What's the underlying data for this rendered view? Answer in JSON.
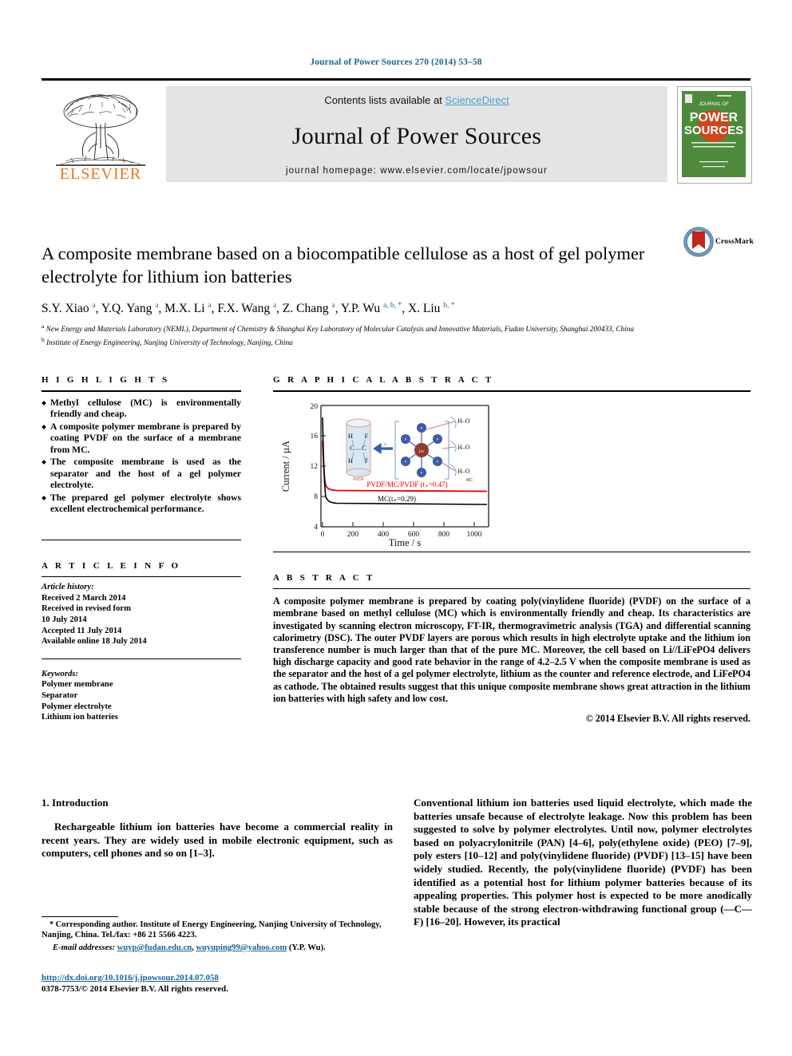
{
  "running_head": "Journal of Power Sources 270 (2014) 53–58",
  "masthead": {
    "publisher_name": "ELSEVIER",
    "contents_prefix": "Contents lists available at ",
    "contents_link": "ScienceDirect",
    "journal_title": "Journal of Power Sources",
    "homepage": "journal homepage: www.elsevier.com/locate/jpowsour",
    "cover_line1": "JOURNAL OF",
    "cover_line2": "POWER",
    "cover_line3": "SOURCES"
  },
  "article": {
    "title": "A composite membrane based on a biocompatible cellulose as a host of gel polymer electrolyte for lithium ion batteries",
    "crossmark_label": "CrossMark",
    "authors": [
      {
        "name": "S.Y. Xiao",
        "marks": "a"
      },
      {
        "name": "Y.Q. Yang",
        "marks": "a"
      },
      {
        "name": "M.X. Li",
        "marks": "a"
      },
      {
        "name": "F.X. Wang",
        "marks": "a"
      },
      {
        "name": "Z. Chang",
        "marks": "a"
      },
      {
        "name": "Y.P. Wu",
        "marks": "a, b, *"
      },
      {
        "name": "X. Liu",
        "marks": "b, *"
      }
    ],
    "affiliations": [
      {
        "mark": "a",
        "text": "New Energy and Materials Laboratory (NEML), Department of Chemistry & Shanghai Key Laboratory of Molecular Catalysis and Innovative Materials, Fudan University, Shanghai 200433, China"
      },
      {
        "mark": "b",
        "text": "Institute of Energy Engineering, Nanjing University of Technology, Nanjing, China"
      }
    ]
  },
  "highlights": {
    "heading": "H I G H L I G H T S",
    "items": [
      "Methyl cellulose (MC) is environmentally friendly and cheap.",
      "A composite polymer membrane is prepared by coating PVDF on the surface of a membrane from MC.",
      "The composite membrane is used as the separator and the host of a gel polymer electrolyte.",
      "The prepared gel polymer electrolyte shows excellent electrochemical performance."
    ]
  },
  "graphical_abstract": {
    "heading": "G R A P H I C A L   A B S T R A C T"
  },
  "chart_data": {
    "type": "line",
    "title": "",
    "xlabel": "Time / s",
    "ylabel": "Current / µA",
    "xlim": [
      0,
      1100
    ],
    "ylim": [
      4,
      20
    ],
    "xticks": [
      0,
      200,
      400,
      600,
      800,
      1000
    ],
    "yticks": [
      4,
      8,
      12,
      16,
      20
    ],
    "grid": false,
    "legend_position": "inline-annotation",
    "series": [
      {
        "name": "PVDF/MC/PVDF (t+=0.47)",
        "color": "#e00000",
        "annotation": "PVDF/MC/PVDF (t₊=0.47)",
        "x": [
          0,
          3,
          6,
          10,
          20,
          50,
          100,
          200,
          400,
          600,
          800,
          1000
        ],
        "y": [
          15.2,
          10.5,
          8.4,
          7.6,
          7.3,
          7.2,
          7.15,
          7.1,
          7.08,
          7.05,
          7.05,
          7.0
        ]
      },
      {
        "name": "MC (t+=0.29)",
        "color": "#000000",
        "annotation": "MC(t₊=0.29)",
        "x": [
          0,
          3,
          6,
          10,
          20,
          50,
          100,
          200,
          400,
          600,
          800,
          1000
        ],
        "y": [
          18.3,
          10.2,
          7.5,
          6.4,
          5.9,
          5.6,
          5.5,
          5.4,
          5.35,
          5.3,
          5.25,
          5.2
        ]
      }
    ],
    "inset": {
      "left_label": "PVDF",
      "right_label": "MC",
      "center_ion": "Li+",
      "arrow_label": "e-",
      "pvdf_atoms": [
        "H",
        "F",
        "C",
        "C",
        "H",
        "F"
      ],
      "solvent_labels": [
        "H–O",
        "H–O",
        "H–O"
      ],
      "ligand_labels": [
        "F",
        "F",
        "F",
        "F",
        "F",
        "F"
      ]
    }
  },
  "article_info": {
    "heading": "A R T I C L E   I N F O",
    "history_label": "Article history:",
    "history": [
      "Received 2 March 2014",
      "Received in revised form",
      "10 July 2014",
      "Accepted 11 July 2014",
      "Available online 18 July 2014"
    ],
    "keywords_label": "Keywords:",
    "keywords": [
      "Polymer membrane",
      "Separator",
      "Polymer electrolyte",
      "Lithium ion batteries"
    ]
  },
  "abstract": {
    "heading": "A B S T R A C T",
    "text": "A composite polymer membrane is prepared by coating poly(vinylidene fluoride) (PVDF) on the surface of a membrane based on methyl cellulose (MC) which is environmentally friendly and cheap. Its characteristics are investigated by scanning electron microscopy, FT-IR, thermogravimetric analysis (TGA) and differential scanning calorimetry (DSC). The outer PVDF layers are porous which results in high electrolyte uptake and the lithium ion transference number is much larger than that of the pure MC. Moreover, the cell based on Li//LiFePO4 delivers high discharge capacity and good rate behavior in the range of 4.2–2.5 V when the composite membrane is used as the separator and the host of a gel polymer electrolyte, lithium as the counter and reference electrode, and LiFePO4 as cathode. The obtained results suggest that this unique composite membrane shows great attraction in the lithium ion batteries with high safety and low cost.",
    "copyright": "© 2014 Elsevier B.V. All rights reserved."
  },
  "body": {
    "section_title": "1.  Introduction",
    "left_paragraph": "Rechargeable lithium ion batteries have become a commercial reality in recent years. They are widely used in mobile electronic equipment, such as computers, cell phones and so on [1–3].",
    "right_paragraph": "Conventional lithium ion batteries used liquid electrolyte, which made the batteries unsafe because of electrolyte leakage. Now this problem has been suggested to solve by polymer electrolytes. Until now, polymer electrolytes based on polyacrylonitrile (PAN) [4–6], poly(ethylene oxide) (PEO) [7–9], poly esters [10–12] and poly(vinylidene fluoride) (PVDF) [13–15] have been widely studied. Recently, the poly(vinylidene fluoride) (PVDF) has been identified as a potential host for lithium polymer batteries because of its appealing properties. This polymer host is expected to be more anodically stable because of the strong electron-withdrawing functional group (—C—F) [16–20]. However, its practical"
  },
  "footer": {
    "corresponding_star": "*",
    "corresponding_text": "Corresponding author. Institute of Energy Engineering, Nanjing University of Technology, Nanjing, China. Tel./fax: +86 21 5566 4223.",
    "email_label": "E-mail addresses:",
    "email1": "wuyp@fudan.edu.cn",
    "email2": "wuyuping99@yahoo.com",
    "email_suffix": "(Y.P. Wu).",
    "doi": "http://dx.doi.org/10.1016/j.jpowsour.2014.07.058",
    "issn_line": "0378-7753/© 2014 Elsevier B.V. All rights reserved."
  },
  "colors": {
    "link_blue": "#1a6496",
    "sciencedirect_blue": "#4a9fd4",
    "elsevier_orange": "#E8761A",
    "chart_red": "#e00000",
    "cover_green": "#4e8a3c"
  }
}
